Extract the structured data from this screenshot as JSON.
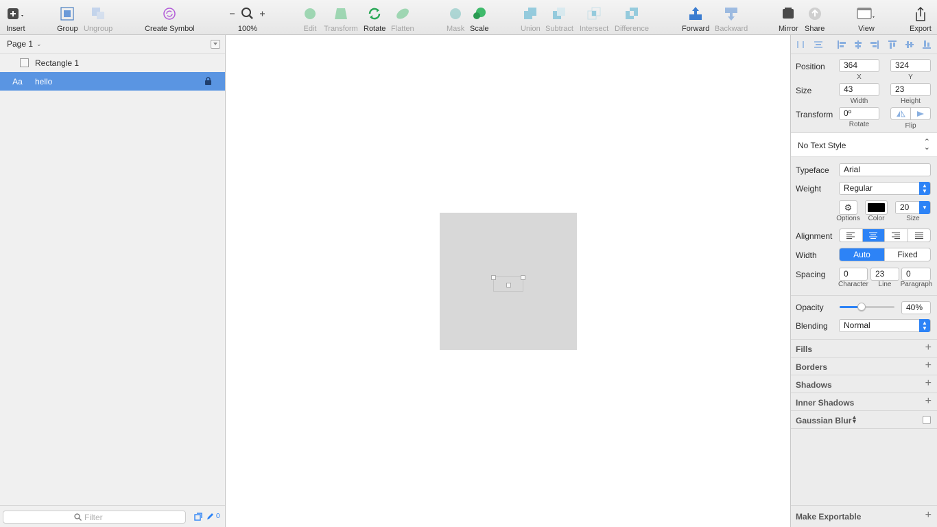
{
  "toolbar": {
    "insert": "Insert",
    "group": "Group",
    "ungroup": "Ungroup",
    "create_symbol": "Create Symbol",
    "zoom": "100%",
    "edit": "Edit",
    "transform": "Transform",
    "rotate": "Rotate",
    "flatten": "Flatten",
    "mask": "Mask",
    "scale": "Scale",
    "union": "Union",
    "subtract": "Subtract",
    "intersect": "Intersect",
    "difference": "Difference",
    "forward": "Forward",
    "backward": "Backward",
    "mirror": "Mirror",
    "share": "Share",
    "view": "View",
    "export": "Export"
  },
  "layers": {
    "page": "Page 1",
    "items": [
      {
        "name": "Rectangle 1",
        "icon": "rectangle-icon"
      },
      {
        "name": "hello",
        "icon": "text-layer-icon",
        "icon_text": "Aa",
        "locked": true,
        "selected": true
      }
    ],
    "filter_placeholder": "Filter",
    "footer_count": "0"
  },
  "inspector": {
    "position_label": "Position",
    "x": "364",
    "x_label": "X",
    "y": "324",
    "y_label": "Y",
    "size_label": "Size",
    "width": "43",
    "width_label": "Width",
    "height": "23",
    "height_label": "Height",
    "transform_label": "Transform",
    "rotate": "0º",
    "rotate_label": "Rotate",
    "flip_label": "Flip",
    "text_style": "No Text Style",
    "typeface_label": "Typeface",
    "typeface": "Arial",
    "weight_label": "Weight",
    "weight": "Regular",
    "options_label": "Options",
    "color_label": "Color",
    "color": "#000000",
    "font_size": "20",
    "size_small_label": "Size",
    "alignment_label": "Alignment",
    "width_mode_label": "Width",
    "width_auto": "Auto",
    "width_fixed": "Fixed",
    "spacing_label": "Spacing",
    "character": "0",
    "character_label": "Character",
    "line": "23",
    "line_label": "Line",
    "paragraph": "0",
    "paragraph_label": "Paragraph",
    "opacity_label": "Opacity",
    "opacity": "40%",
    "opacity_value": 40,
    "blending_label": "Blending",
    "blending": "Normal",
    "sections": [
      "Fills",
      "Borders",
      "Shadows",
      "Inner Shadows"
    ],
    "gaussian_blur": "Gaussian Blur",
    "make_exportable": "Make Exportable"
  },
  "colors": {
    "accent": "#2d83f6",
    "selection": "#5a95e2"
  }
}
